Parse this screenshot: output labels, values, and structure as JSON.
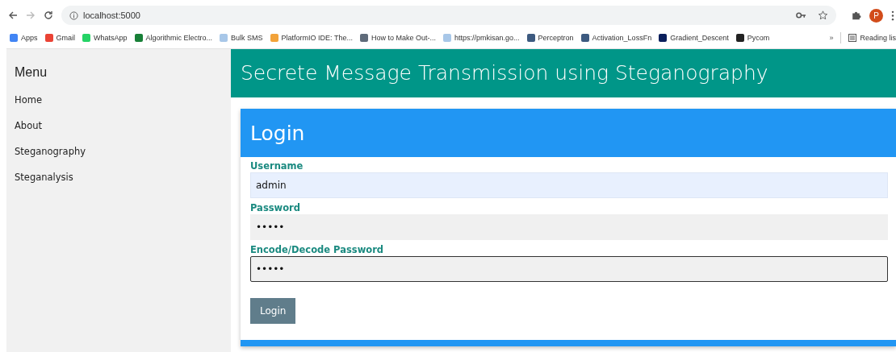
{
  "browser": {
    "url": "localhost:5000",
    "bookmarks": [
      {
        "label": "Apps",
        "color": "#4285f4"
      },
      {
        "label": "Gmail",
        "color": "#ea4335"
      },
      {
        "label": "WhatsApp",
        "color": "#25d366"
      },
      {
        "label": "Algorithmic Electro...",
        "color": "#188038"
      },
      {
        "label": "Bulk SMS",
        "color": "#a8c7e8"
      },
      {
        "label": "PlatformIO IDE: The...",
        "color": "#f2a33a"
      },
      {
        "label": "How to Make Out-...",
        "color": "#5f6b7a"
      },
      {
        "label": "https://pmkisan.go...",
        "color": "#a8c7e8"
      },
      {
        "label": "Perceptron",
        "color": "#3d5a80"
      },
      {
        "label": "Activation_LossFn",
        "color": "#3d5a80"
      },
      {
        "label": "Gradient_Descent",
        "color": "#0b1f5c"
      },
      {
        "label": "Pycom",
        "color": "#222222"
      }
    ],
    "overflow": "»",
    "reading_list": "Reading lis",
    "profile": "P"
  },
  "sidebar": {
    "title": "Menu",
    "items": [
      "Home",
      "About",
      "Steganography",
      "Steganalysis"
    ]
  },
  "header": {
    "title": "Secrete Message Transmission using Steganography"
  },
  "login": {
    "title": "Login",
    "fields": [
      {
        "label": "Username",
        "value": "admin",
        "focused": false,
        "autofilled": true
      },
      {
        "label": "Password",
        "value": "•••••",
        "focused": false,
        "autofilled": false
      },
      {
        "label": "Encode/Decode Password",
        "value": "•••••",
        "focused": true,
        "autofilled": false
      }
    ],
    "button": "Login"
  }
}
